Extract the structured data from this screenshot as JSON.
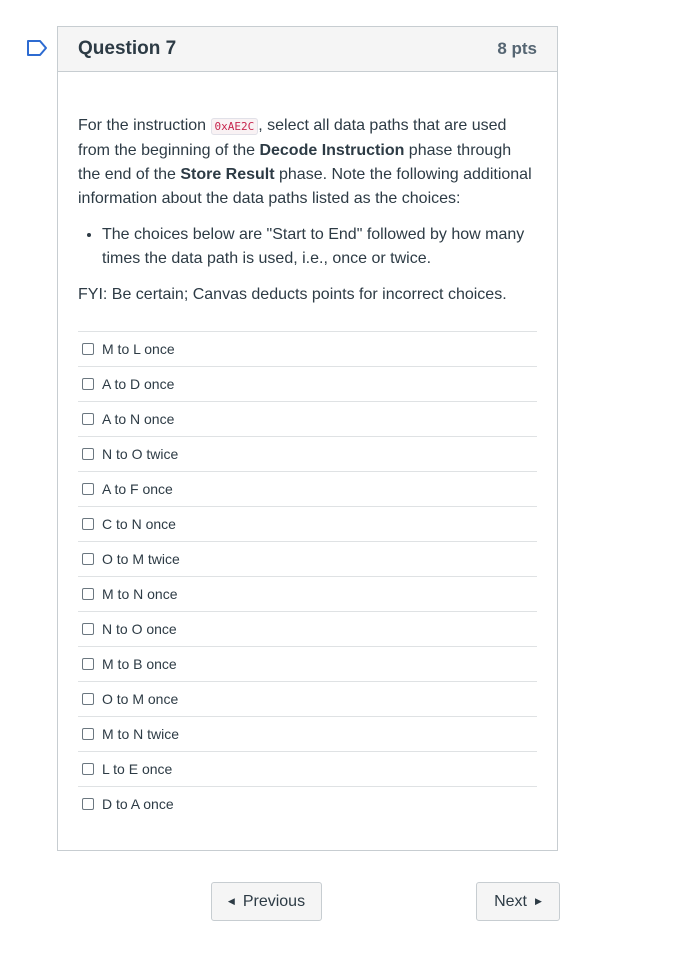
{
  "question": {
    "title": "Question 7",
    "points": "8 pts",
    "text_intro": "For the instruction ",
    "instruction_code": "0xAE2C",
    "text_after_code": ", select all data paths that are used from the beginning of the ",
    "phase_start": "Decode Instruction",
    "text_middle": " phase through the end of the ",
    "phase_end": "Store Result",
    "text_end": " phase. Note the following additional information about the data paths listed as the choices:",
    "bullet": "The choices below are \"Start to End\" followed by how many times the data path is used, i.e., once or twice.",
    "fyi": "FYI: Be certain; Canvas deducts points for incorrect choices."
  },
  "answers": [
    {
      "label": "M to L once",
      "checked": false
    },
    {
      "label": "A to D once",
      "checked": false
    },
    {
      "label": "A to N once",
      "checked": false
    },
    {
      "label": "N to O twice",
      "checked": false
    },
    {
      "label": "A to F once",
      "checked": false
    },
    {
      "label": "C to N once",
      "checked": false
    },
    {
      "label": "O to M twice",
      "checked": false
    },
    {
      "label": "M to N once",
      "checked": false
    },
    {
      "label": "N to O once",
      "checked": false
    },
    {
      "label": "M to B once",
      "checked": false
    },
    {
      "label": "O to M once",
      "checked": false
    },
    {
      "label": "M to N twice",
      "checked": false
    },
    {
      "label": "L to E once",
      "checked": false
    },
    {
      "label": "D to A once",
      "checked": false
    }
  ],
  "nav": {
    "previous_label": "Previous",
    "next_label": "Next"
  },
  "colors": {
    "flag": "#2d6bd1",
    "code_text": "#c7254e",
    "header_bg": "#f5f5f5"
  },
  "icons": {
    "flag": "flag-icon",
    "prev": "caret-left-icon",
    "next": "caret-right-icon"
  }
}
